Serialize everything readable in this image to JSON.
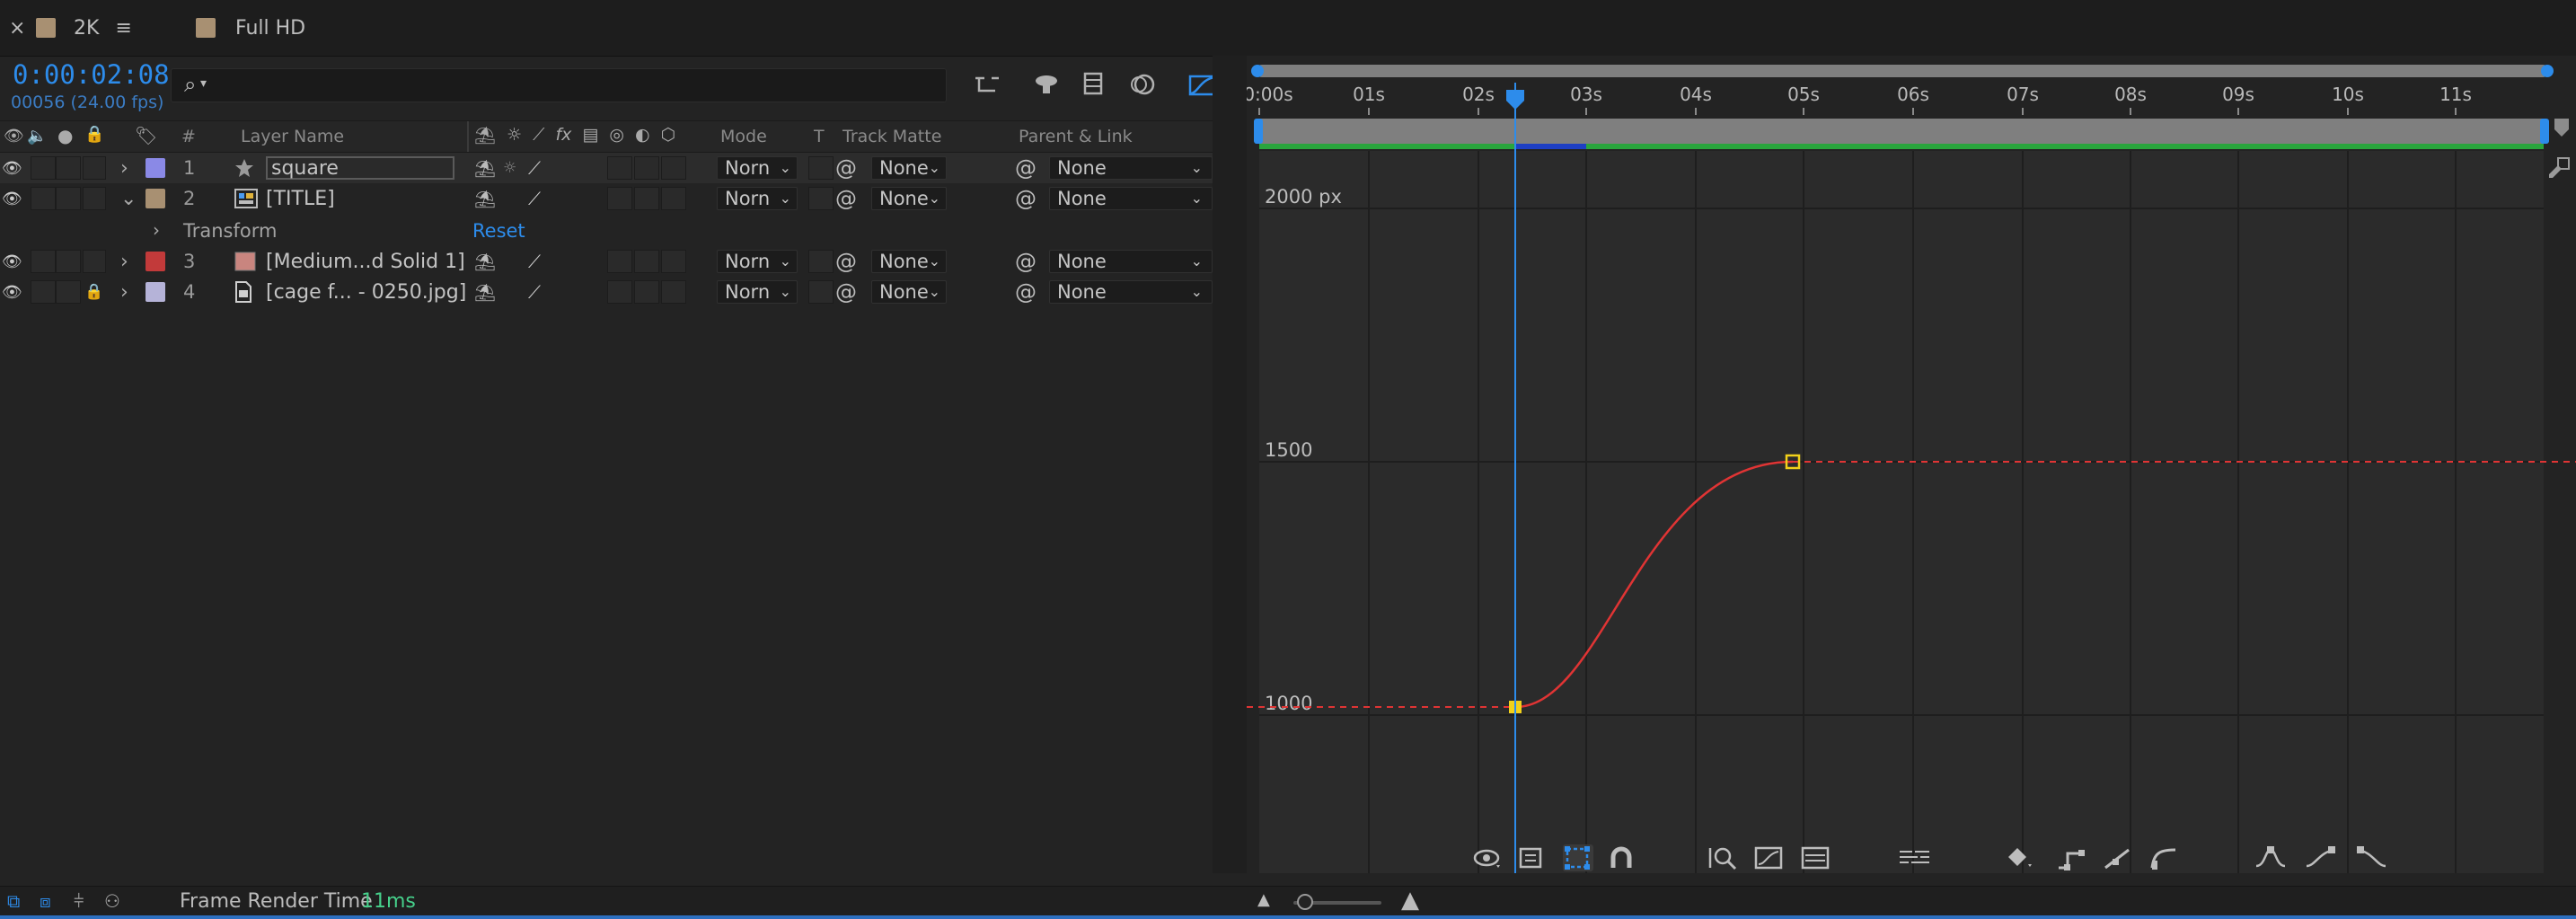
{
  "tabs": [
    {
      "label": "2K",
      "color": "#a89072"
    },
    {
      "label": "Full HD",
      "color": "#a89072"
    }
  ],
  "timecode": "0:00:02:08",
  "frame_info": "00056 (24.00 fps)",
  "search": {
    "placeholder": ""
  },
  "columns": {
    "number": "#",
    "layer_name": "Layer Name",
    "mode": "Mode",
    "t": "T",
    "track_matte": "Track Matte",
    "parent_link": "Parent & Link"
  },
  "layers": [
    {
      "index": "1",
      "name": "square",
      "label_color": "#8a89e6",
      "mode": "Norn",
      "track_matte": "None",
      "parent": "None",
      "icon": "star-icon",
      "locked": false,
      "expanded": false
    },
    {
      "index": "2",
      "name": "[TITLE]",
      "label_color": "#a89072",
      "mode": "Norn",
      "track_matte": "None",
      "parent": "None",
      "icon": "composition-icon",
      "locked": false,
      "expanded": true
    },
    {
      "index": "3",
      "name": "[Medium...d Solid 1]",
      "label_color": "#c23a3a",
      "mode": "Norn",
      "track_matte": "None",
      "parent": "None",
      "icon": "solid-icon",
      "locked": false,
      "expanded": false
    },
    {
      "index": "4",
      "name": "[cage f... - 0250.jpg]",
      "label_color": "#b5b3d8",
      "mode": "Norn",
      "track_matte": "None",
      "parent": "None",
      "icon": "footage-icon",
      "locked": true,
      "expanded": false
    }
  ],
  "transform": {
    "label": "Transform",
    "reset": "Reset"
  },
  "ruler": {
    "ticks": [
      "0:00s",
      "01s",
      "02s",
      "03s",
      "04s",
      "05s",
      "06s",
      "07s",
      "08s",
      "09s",
      "10s",
      "11s"
    ]
  },
  "graph": {
    "y_labels": [
      "2000 px",
      "1500",
      "1000"
    ],
    "curve_color": "#e03434",
    "keyframe_color": "#f2d11a",
    "playhead_color": "#2d8ceb"
  },
  "bottom": {
    "frame_render_label": "Frame Render Time",
    "frame_render_value": "11ms"
  }
}
